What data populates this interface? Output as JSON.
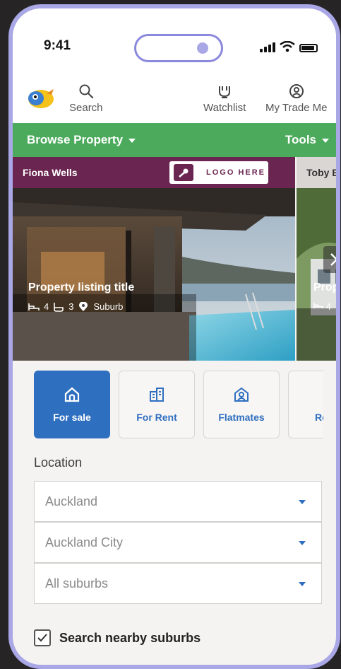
{
  "status_bar": {
    "time": "9:41"
  },
  "header": {
    "search_label": "Search",
    "watchlist_label": "Watchlist",
    "my_trade_me_label": "My Trade Me"
  },
  "nav": {
    "browse_label": "Browse Property",
    "tools_label": "Tools"
  },
  "listings": [
    {
      "agent": "Fiona Wells",
      "logo_text": "LOGO HERE",
      "title": "Property listing title",
      "beds": "4",
      "baths": "3",
      "suburb": "Suburb"
    },
    {
      "agent": "Toby Be",
      "title": "Prop",
      "beds": "4"
    }
  ],
  "categories": [
    {
      "label": "For sale",
      "icon": "house-icon",
      "active": true
    },
    {
      "label": "For Rent",
      "icon": "apartment-icon",
      "active": false
    },
    {
      "label": "Flatmates",
      "icon": "flatmates-icon",
      "active": false
    },
    {
      "label": "Retir",
      "icon": "retirement-icon",
      "active": false
    }
  ],
  "location": {
    "label": "Location",
    "region": "Auckland",
    "district": "Auckland City",
    "suburb": "All suburbs"
  },
  "nearby": {
    "label": "Search nearby suburbs",
    "checked": true
  },
  "colors": {
    "nav_green": "#4caa5c",
    "agent_maroon": "#6a2550",
    "accent_blue": "#2f6fc0",
    "frame": "#a9a7e6"
  }
}
